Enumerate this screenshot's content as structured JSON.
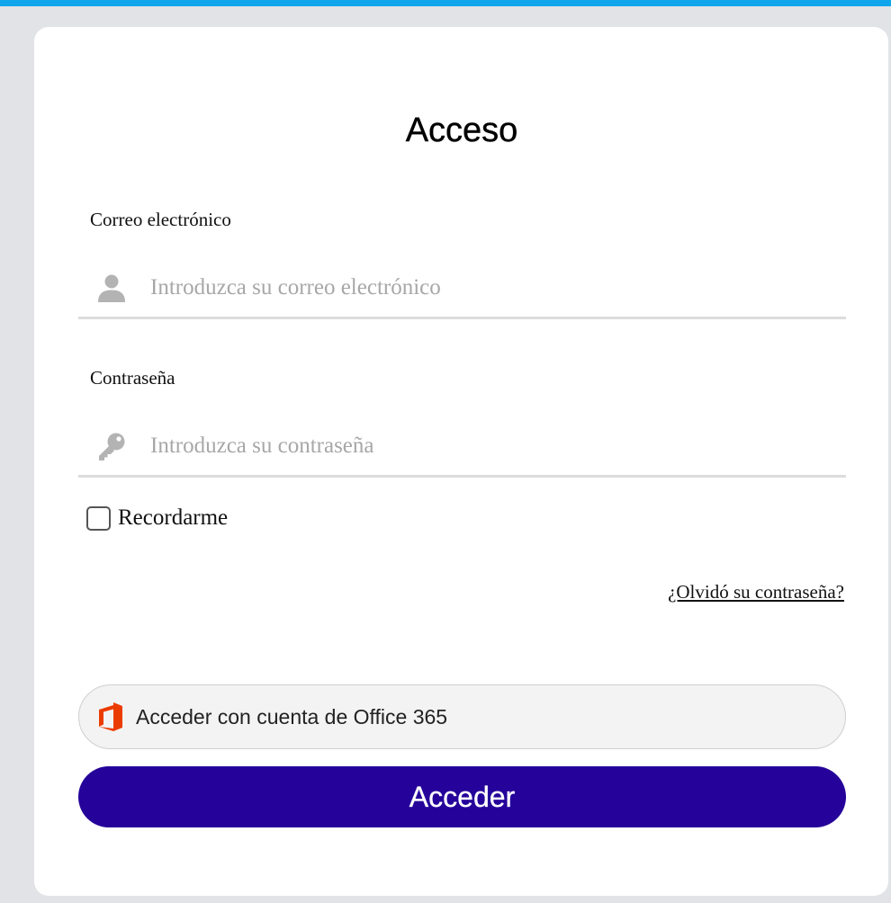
{
  "login": {
    "title": "Acceso",
    "email": {
      "label": "Correo electrónico",
      "placeholder": "Introduzca su correo electrónico",
      "value": "",
      "icon": "user-icon"
    },
    "password": {
      "label": "Contraseña",
      "placeholder": "Introduzca su contraseña",
      "value": "",
      "icon": "key-icon"
    },
    "remember": {
      "label": "Recordarme",
      "checked": false
    },
    "forgot_link": "¿Olvidó su contraseña?",
    "office_button": {
      "label": "Acceder con cuenta de Office 365",
      "icon": "office-365-icon"
    },
    "submit_label": "Acceder"
  },
  "colors": {
    "top_bar": "#10a6ec",
    "background": "#e2e3e7",
    "card": "#ffffff",
    "primary_button": "#25039a",
    "office_brand": "#eb3c00",
    "placeholder": "#a7a7a7",
    "icon": "#b3b3b3"
  }
}
